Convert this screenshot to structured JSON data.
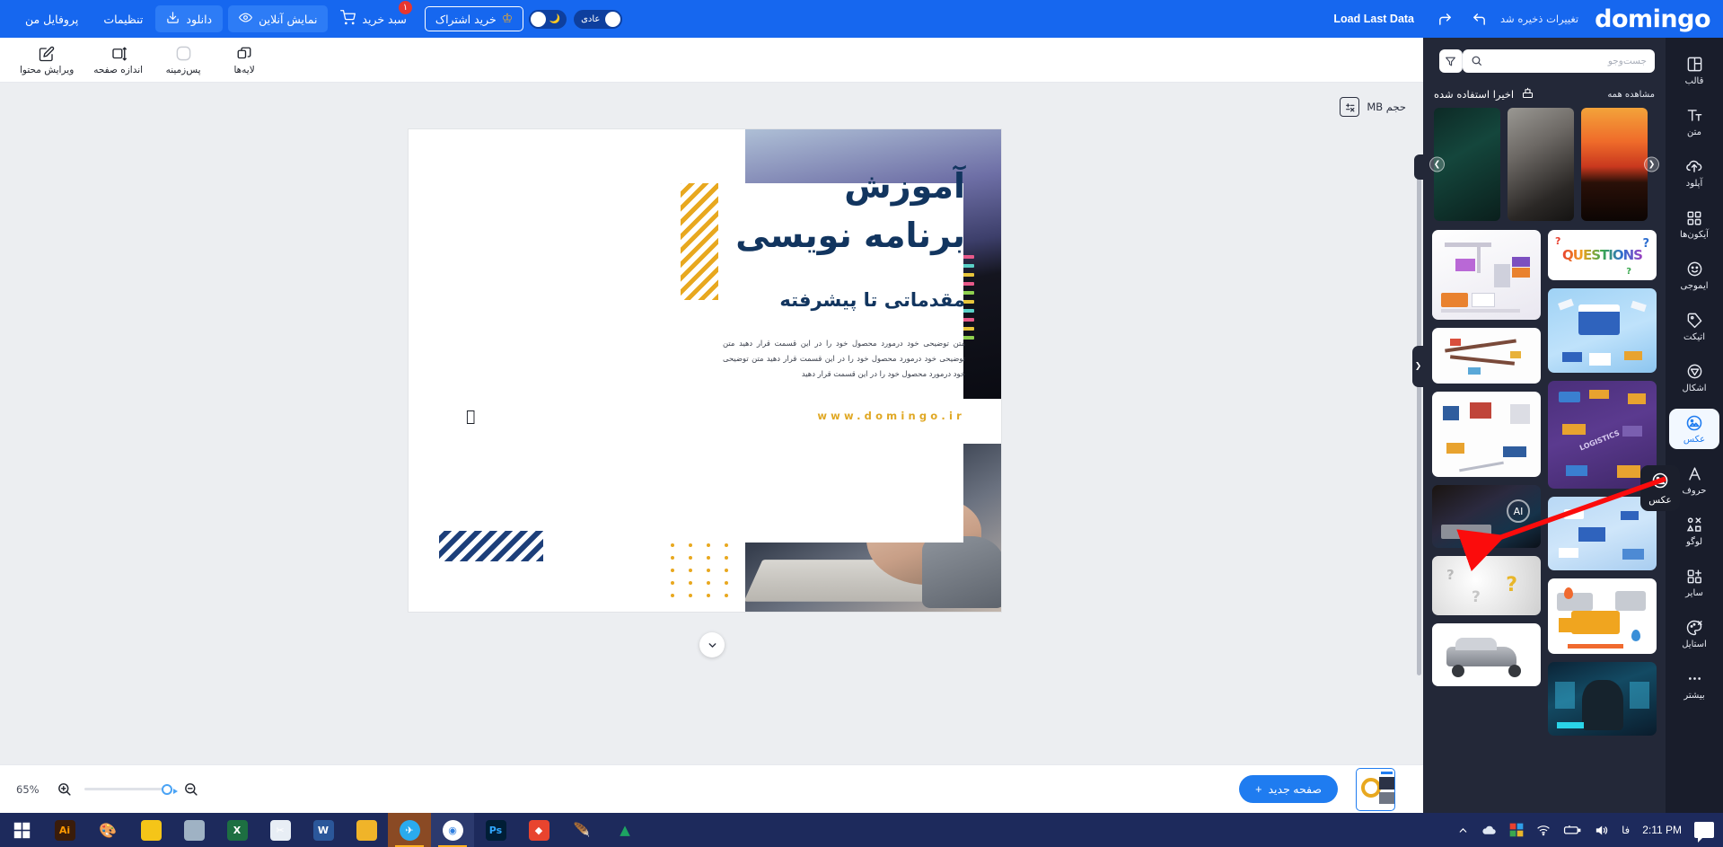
{
  "topbar": {
    "logo": "domingo",
    "saved_text": "تغییرات ذخیره شد",
    "load_last_data": "Load Last Data",
    "profile": "پروفایل من",
    "settings": "تنظیمات",
    "download": "دانلود",
    "online_preview": "نمایش آنلاین",
    "cart": "سبد خرید",
    "cart_badge": "۱",
    "subscribe": "خرید اشتراک",
    "mode_label": "عادی",
    "accent": "#1667ef"
  },
  "toolbar": {
    "items": [
      {
        "label": "ویرایش محتوا",
        "icon": "edit-pencil-icon"
      },
      {
        "label": "اندازه صفحه",
        "icon": "resize-icon"
      },
      {
        "label": "پس‌زمینه",
        "icon": "background-icon"
      },
      {
        "label": "لایه‌ها",
        "icon": "layers-icon"
      }
    ]
  },
  "canvas": {
    "size_chip": "حجم MB",
    "poster": {
      "title_line1": "آموزش",
      "title_line2": "برنامه نویسی",
      "subtitle": "مقدماتی تا پیشرفته",
      "body": "متن توضیحی خود درمورد محصول خود را در این قسمت قرار دهید متن توضیحی خود درمورد محصول خود را در این قسمت قرار دهید متن توضیحی خود درمورد محصول خود را در این قسمت قرار دهید",
      "url": "www.domingo.ir",
      "colors": {
        "navy": "#12355f",
        "gold": "#e8a81f"
      }
    }
  },
  "bottombar": {
    "zoom_level": "65%",
    "new_page": "صفحه جدید",
    "plus": "+"
  },
  "panel": {
    "search_placeholder": "جست‌وجو",
    "search_value": "",
    "section_title": "اخیرا استفاده شده",
    "see_all": "مشاهده همه",
    "recent": [
      {
        "name": "sunset-landscape"
      },
      {
        "name": "mother-and-baby"
      },
      {
        "name": "pine-branches"
      }
    ],
    "tiles_right": [
      {
        "name": "shipping-containers-crane"
      },
      {
        "name": "road-logistics-isometric"
      },
      {
        "name": "logistics-network-isometric"
      },
      {
        "name": "ai-laptop-photo"
      },
      {
        "name": "question-marks-pile"
      },
      {
        "name": "crashed-car"
      }
    ],
    "tiles_left": [
      {
        "name": "questions-typography"
      },
      {
        "name": "warehouse-isometric-blue"
      },
      {
        "name": "logistics-purple-isometric"
      },
      {
        "name": "world-map-shipping-blue"
      },
      {
        "name": "orange-delivery-truck-map"
      },
      {
        "name": "hooded-hacker"
      }
    ]
  },
  "rail": {
    "items": [
      {
        "label": "قالب",
        "icon": "template-icon",
        "active": false
      },
      {
        "label": "متن",
        "icon": "text-icon",
        "active": false
      },
      {
        "label": "آپلود",
        "icon": "upload-cloud-icon",
        "active": false
      },
      {
        "label": "آیکون‌ها",
        "icon": "grid-icon",
        "active": false
      },
      {
        "label": "ایموجی",
        "icon": "emoji-icon",
        "active": false
      },
      {
        "label": "اتیکت",
        "icon": "tag-icon",
        "active": false
      },
      {
        "label": "اشکال",
        "icon": "shapes-icon",
        "active": false
      },
      {
        "label": "عکس",
        "icon": "image-icon",
        "active": true
      },
      {
        "label": "حروف",
        "icon": "letter-icon",
        "active": false
      },
      {
        "label": "لوگو",
        "icon": "logo-icon",
        "active": false
      },
      {
        "label": "سایر",
        "icon": "other-plus-icon",
        "active": false
      },
      {
        "label": "استایل",
        "icon": "style-palette-icon",
        "active": false
      },
      {
        "label": "بیشتر",
        "icon": "more-dots-icon",
        "active": false
      }
    ],
    "tooltip": "عکس"
  },
  "taskbar": {
    "apps": [
      {
        "name": "start-button",
        "glyph": "",
        "color": "#1d2a5c"
      },
      {
        "name": "adobe-illustrator",
        "glyph": "Ai",
        "color": "#3a1c0a"
      },
      {
        "name": "paint",
        "glyph": "🎨",
        "color": "#2f6fbf"
      },
      {
        "name": "sticky-notes",
        "glyph": "",
        "color": "#f5c518"
      },
      {
        "name": "calculator",
        "glyph": "",
        "color": "#8fa3b8"
      },
      {
        "name": "excel",
        "glyph": "X",
        "color": "#1d6f42"
      },
      {
        "name": "snipping-tool",
        "glyph": "",
        "color": "#5b8ec4"
      },
      {
        "name": "word",
        "glyph": "W",
        "color": "#2b579a"
      },
      {
        "name": "file-explorer",
        "glyph": "",
        "color": "#f0b429"
      },
      {
        "name": "telegram",
        "glyph": "✈",
        "color": "#2aabee"
      },
      {
        "name": "google-chrome",
        "glyph": "",
        "color": "#ffffff"
      },
      {
        "name": "photoshop",
        "glyph": "Ps",
        "color": "#001e36"
      },
      {
        "name": "vscode-insiders",
        "glyph": "◆",
        "color": "#e8442e"
      },
      {
        "name": "feather-app",
        "glyph": "🪶",
        "color": "#9b7fd4"
      },
      {
        "name": "google-drive",
        "glyph": "▲",
        "color": "#1da462"
      }
    ],
    "time": "2:11 PM",
    "lang": "فا"
  }
}
